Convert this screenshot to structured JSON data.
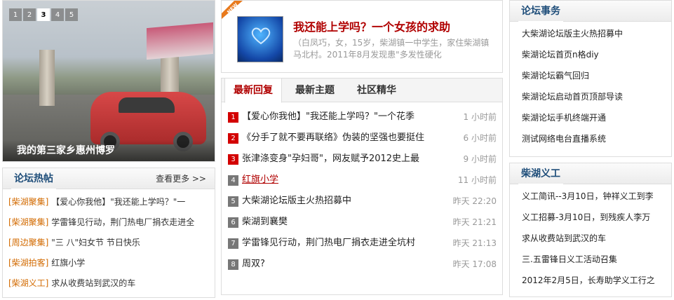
{
  "slider": {
    "pages": [
      "1",
      "2",
      "3",
      "4",
      "5"
    ],
    "active_page": "3",
    "caption": "我的第三家乡惠州博罗"
  },
  "hot_posts": {
    "title": "论坛热帖",
    "more_label": "查看更多 >>",
    "items": [
      {
        "tag": "[柴湖聚集]",
        "text": "【爱心你我他】\"我还能上学吗？\"一"
      },
      {
        "tag": "[柴湖聚集]",
        "text": "学雷锋见行动，荆门热电厂捐衣走进全"
      },
      {
        "tag": "[周边聚集]",
        "text": "\"三 八\"妇女节 节日快乐"
      },
      {
        "tag": "[柴湖拍客]",
        "text": "红旗小学"
      },
      {
        "tag": "[柴湖义工]",
        "text": "求从收费站到武汉的车"
      }
    ]
  },
  "feature": {
    "badge": "NEW",
    "title": "我还能上学吗？一个女孩的求助",
    "desc": "（白凤巧，女，15岁，柴湖镇一中学生，家住柴湖镇马北村。2011年8月发现患\"多发性硬化"
  },
  "tabs": [
    {
      "label": "最新回复",
      "active": true
    },
    {
      "label": "最新主题",
      "active": false
    },
    {
      "label": "社区精华",
      "active": false
    }
  ],
  "posts": [
    {
      "num": "1",
      "text": "【爱心你我他】\"我还能上学吗？\"一个花季",
      "time": "1 小时前",
      "hot": true,
      "link": false
    },
    {
      "num": "2",
      "text": "《分手了就不要再联络》伪装的坚强也要挺住",
      "time": "6 小时前",
      "hot": true,
      "link": false
    },
    {
      "num": "3",
      "text": "张津涤变身\"孕妇哥\"，网友赋予2012史上最",
      "time": "9 小时前",
      "hot": true,
      "link": false
    },
    {
      "num": "4",
      "text": "红旗小学",
      "time": "11 小时前",
      "hot": false,
      "link": true
    },
    {
      "num": "5",
      "text": "大柴湖论坛版主火热招募中",
      "time": "昨天 22:20",
      "hot": false,
      "link": false
    },
    {
      "num": "6",
      "text": "柴湖到襄樊",
      "time": "昨天 21:21",
      "hot": false,
      "link": false
    },
    {
      "num": "7",
      "text": "学雷锋见行动，荆门热电厂捐衣走进全坑村",
      "time": "昨天 21:13",
      "hot": false,
      "link": false
    },
    {
      "num": "8",
      "text": "周双?",
      "time": "昨天 17:08",
      "hot": false,
      "link": false
    }
  ],
  "forum_affairs": {
    "title": "论坛事务",
    "items": [
      "大柴湖论坛版主火热招募中",
      "柴湖论坛首页n格diy",
      "柴湖论坛霸气回归",
      "柴湖论坛启动首页顶部导读",
      "柴湖论坛手机终端开通",
      "测试网络电台直播系统"
    ]
  },
  "volunteer": {
    "title": "柴湖义工",
    "items": [
      "义工简讯--3月10日，钟祥义工到李",
      "义工招募-3月10日，到残疾人李万",
      "求从收费站到武汉的车",
      "三.五雷锋日义工活动召集",
      "2012年2月5日，长寿助学义工行之"
    ]
  },
  "colors": {
    "accent_red": "#b00000",
    "title_blue": "#1f4e7a",
    "tag_orange": "#d26a00"
  }
}
